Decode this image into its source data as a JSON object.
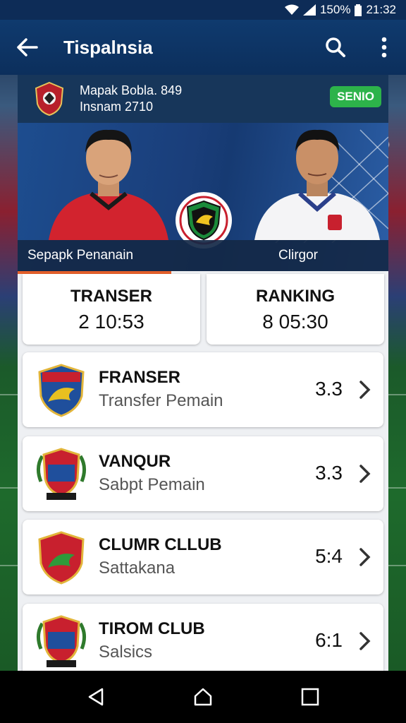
{
  "status_bar": {
    "battery": "150%",
    "time": "21:32"
  },
  "app_bar": {
    "title": "Tispalnsia"
  },
  "match": {
    "line1": "Mapak Bobla. 849",
    "line2": "Insnam 2710",
    "badge": "SENIO",
    "player_left": "Sepapk Penanain",
    "player_right": "Clirgor"
  },
  "stats": [
    {
      "label": "TRANSER",
      "value": "2 10:53"
    },
    {
      "label": "RANKING",
      "value": "8 05:30"
    }
  ],
  "clubs": [
    {
      "name": "FRANSER",
      "sub": "Transfer Pemain",
      "score": "3.3"
    },
    {
      "name": "VANQUR",
      "sub": "Sabpt Pemain",
      "score": "3.3"
    },
    {
      "name": "CLUMR CLLUB",
      "sub": "Sattakana",
      "score": "5:4"
    },
    {
      "name": "TIROM CLUB",
      "sub": "Salsics",
      "score": "6:1"
    }
  ],
  "colors": {
    "app_bar": "#0f3a6e",
    "badge": "#2db34a",
    "accent": "#e5602a"
  }
}
